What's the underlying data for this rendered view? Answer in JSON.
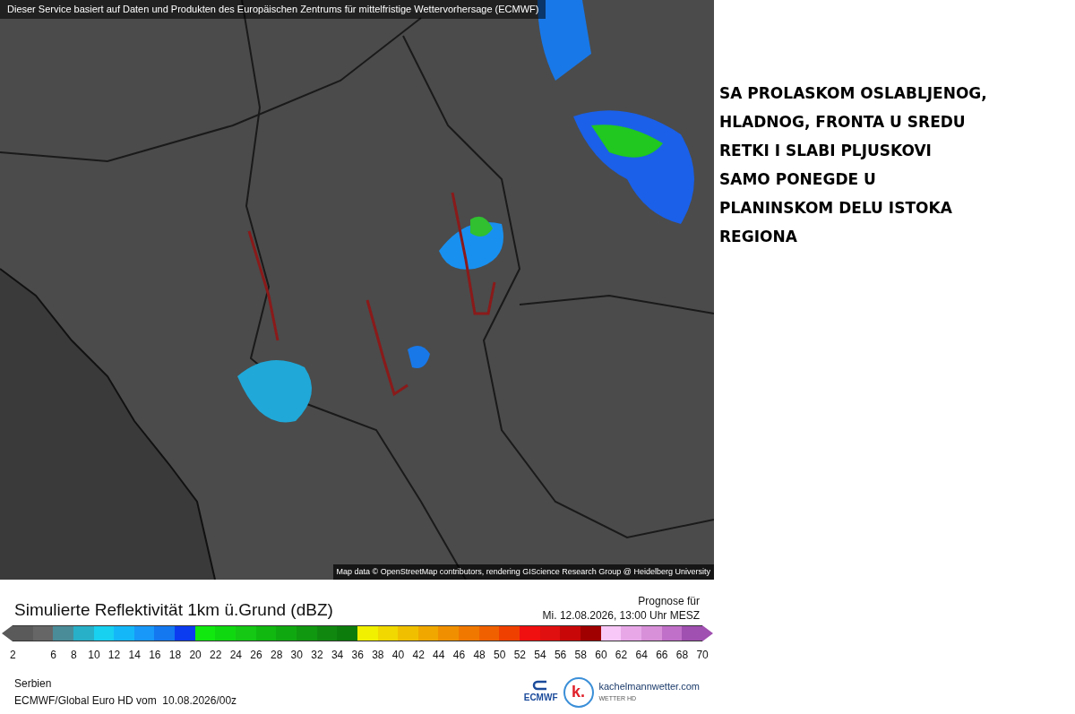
{
  "map": {
    "banner": "Dieser Service basiert auf Daten und Produkten des Europäischen Zentrums für mittelfristige Wettervorhersage (ECMWF)",
    "attribution": "Map data © OpenStreetMap contributors, rendering GIScience Research Group @ Heidelberg University"
  },
  "legend": {
    "title": "Simulierte Reflektivität 1km ü.Grund (dBZ)",
    "forecast_label": "Prognose für",
    "forecast_time": "Mi. 12.08.2026, 13:00 Uhr MESZ",
    "segments": [
      {
        "color": "#5a5a5a",
        "tick": "2"
      },
      {
        "color": "#666666"
      },
      {
        "color": "#4a8c98",
        "tick": "6"
      },
      {
        "color": "#28b0c8",
        "tick": "8"
      },
      {
        "color": "#18d0f0",
        "tick": "10"
      },
      {
        "color": "#14b8f8",
        "tick": "12"
      },
      {
        "color": "#1898f8",
        "tick": "14"
      },
      {
        "color": "#1478f0",
        "tick": "16"
      },
      {
        "color": "#0c3cf0",
        "tick": "18"
      },
      {
        "color": "#10e810",
        "tick": "20"
      },
      {
        "color": "#10d810",
        "tick": "22"
      },
      {
        "color": "#14c814",
        "tick": "24"
      },
      {
        "color": "#10b810",
        "tick": "26"
      },
      {
        "color": "#10a810",
        "tick": "28"
      },
      {
        "color": "#109810",
        "tick": "30"
      },
      {
        "color": "#108810",
        "tick": "32"
      },
      {
        "color": "#0c7c0c",
        "tick": "34"
      },
      {
        "color": "#f0f000",
        "tick": "36"
      },
      {
        "color": "#f0d800",
        "tick": "38"
      },
      {
        "color": "#f0c000",
        "tick": "40"
      },
      {
        "color": "#f0a800",
        "tick": "42"
      },
      {
        "color": "#f09000",
        "tick": "44"
      },
      {
        "color": "#f07800",
        "tick": "46"
      },
      {
        "color": "#f06000",
        "tick": "48"
      },
      {
        "color": "#f04000",
        "tick": "50"
      },
      {
        "color": "#f01010",
        "tick": "52"
      },
      {
        "color": "#e01010",
        "tick": "54"
      },
      {
        "color": "#c80808",
        "tick": "56"
      },
      {
        "color": "#a00000",
        "tick": "58"
      },
      {
        "color": "#f8c8f8",
        "tick": "60"
      },
      {
        "color": "#e8a8e8",
        "tick": "62"
      },
      {
        "color": "#d890d8",
        "tick": "64"
      },
      {
        "color": "#c070c8",
        "tick": "66"
      },
      {
        "color": "#a050b0",
        "tick": "68"
      }
    ],
    "end_tick": "70"
  },
  "footer": {
    "region": "Serbien",
    "model_run": "ECMWF/Global Euro HD vom  10.08.2026/00z",
    "ecmwf_logo": "ECMWF",
    "k_logo": "k.",
    "site": "kachelmannwetter.com",
    "site_sub": "WETTER HD"
  },
  "note": {
    "lines": [
      "SA PROLASKOM OSLABLJENOG,",
      "HLADNOG, FRONTA U SREDU",
      "RETKI I SLABI PLJUSKOVI",
      "SAMO PONEGDE U",
      "PLANINSKOM DELU ISTOKA",
      "REGIONA"
    ]
  }
}
